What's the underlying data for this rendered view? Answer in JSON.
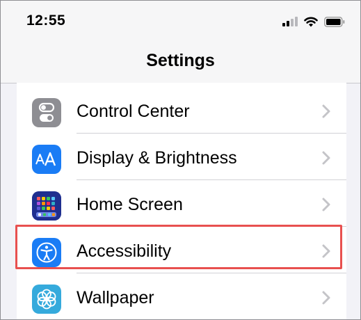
{
  "status_bar": {
    "time": "12:55"
  },
  "nav": {
    "title": "Settings"
  },
  "settings_list": [
    {
      "label": "Control Center",
      "icon": "toggle-switches-icon",
      "icon_color": "#8e8e93"
    },
    {
      "label": "Display & Brightness",
      "icon": "text-size-icon",
      "icon_color": "#1a7cf5"
    },
    {
      "label": "Home Screen",
      "icon": "app-grid-icon",
      "icon_color": "#2d3eb8"
    },
    {
      "label": "Accessibility",
      "icon": "accessibility-icon",
      "icon_color": "#1a7cf5",
      "highlighted": true
    },
    {
      "label": "Wallpaper",
      "icon": "flower-icon",
      "icon_color": "#35aadc"
    }
  ],
  "colors": {
    "highlight_border": "#e8504f",
    "chevron": "#c4c4c8",
    "background": "#f2f2f7"
  }
}
